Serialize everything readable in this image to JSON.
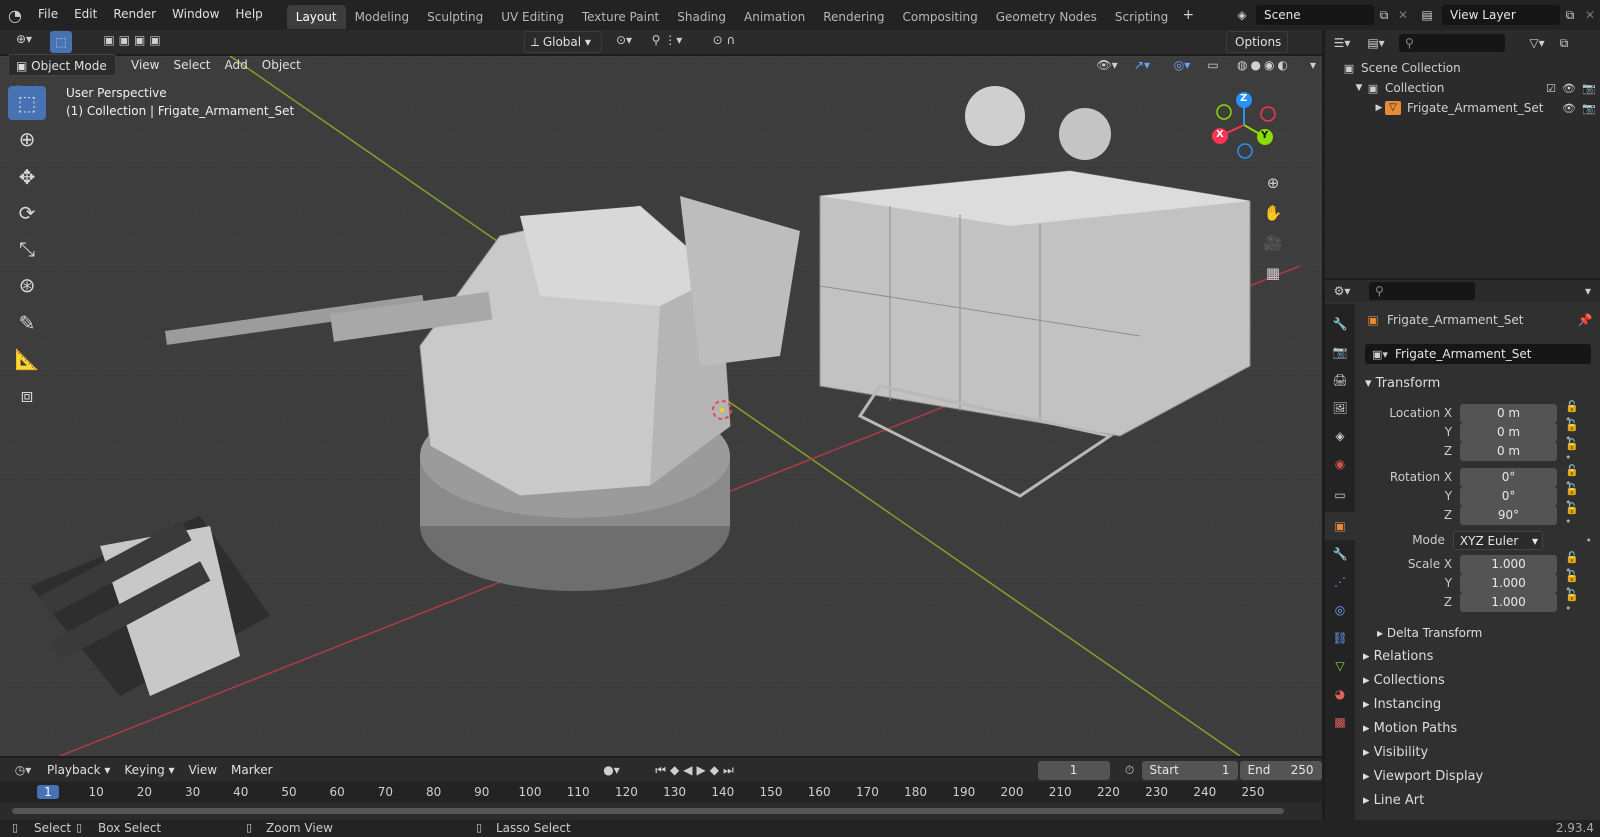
{
  "menu": {
    "file": "File",
    "edit": "Edit",
    "render": "Render",
    "window": "Window",
    "help": "Help"
  },
  "workspaces": [
    "Layout",
    "Modeling",
    "Sculpting",
    "UV Editing",
    "Texture Paint",
    "Shading",
    "Animation",
    "Rendering",
    "Compositing",
    "Geometry Nodes",
    "Scripting"
  ],
  "scene_name": "Scene",
  "view_layer": "View Layer",
  "header": {
    "transform_orientation": "Global",
    "options": "Options"
  },
  "viewport_header": {
    "mode": "Object Mode",
    "view": "View",
    "select": "Select",
    "add": "Add",
    "object": "Object"
  },
  "viewport_info": {
    "line1": "User Perspective",
    "line2": "(1) Collection | Frigate_Armament_Set"
  },
  "gizmo": {
    "z": "Z",
    "y": "Y",
    "x": "X"
  },
  "outliner": {
    "scene_collection": "Scene Collection",
    "collection": "Collection",
    "object": "Frigate_Armament_Set"
  },
  "properties": {
    "object_name": "Frigate_Armament_Set",
    "data_name": "Frigate_Armament_Set",
    "transform_title": "Transform",
    "location_x_label": "Location X",
    "location_x": "0 m",
    "location_y_label": "Y",
    "location_y": "0 m",
    "location_z_label": "Z",
    "location_z": "0 m",
    "rotation_x_label": "Rotation X",
    "rotation_x": "0°",
    "rotation_y_label": "Y",
    "rotation_y": "0°",
    "rotation_z_label": "Z",
    "rotation_z": "90°",
    "mode_label": "Mode",
    "mode": "XYZ Euler",
    "scale_x_label": "Scale X",
    "scale_x": "1.000",
    "scale_y_label": "Y",
    "scale_y": "1.000",
    "scale_z_label": "Z",
    "scale_z": "1.000",
    "delta": "Delta Transform",
    "sections": [
      "Relations",
      "Collections",
      "Instancing",
      "Motion Paths",
      "Visibility",
      "Viewport Display",
      "Line Art"
    ]
  },
  "timeline": {
    "playback": "Playback",
    "keying": "Keying",
    "view": "View",
    "marker": "Marker",
    "current_frame": "1",
    "start_label": "Start",
    "start": "1",
    "end_label": "End",
    "end": "250",
    "ticks": [
      "1",
      "10",
      "20",
      "30",
      "40",
      "50",
      "60",
      "70",
      "80",
      "90",
      "100",
      "110",
      "120",
      "130",
      "140",
      "150",
      "160",
      "170",
      "180",
      "190",
      "200",
      "210",
      "220",
      "230",
      "240",
      "250"
    ]
  },
  "status": {
    "select": "Select",
    "box_select": "Box Select",
    "zoom_view": "Zoom View",
    "lasso_select": "Lasso Select",
    "version": "2.93.4"
  },
  "colors": {
    "accent": "#4772b3",
    "axis_x": "#ff3352",
    "axis_y": "#8bdc00",
    "axis_z": "#2890ff",
    "object_orange": "#e88a37"
  }
}
